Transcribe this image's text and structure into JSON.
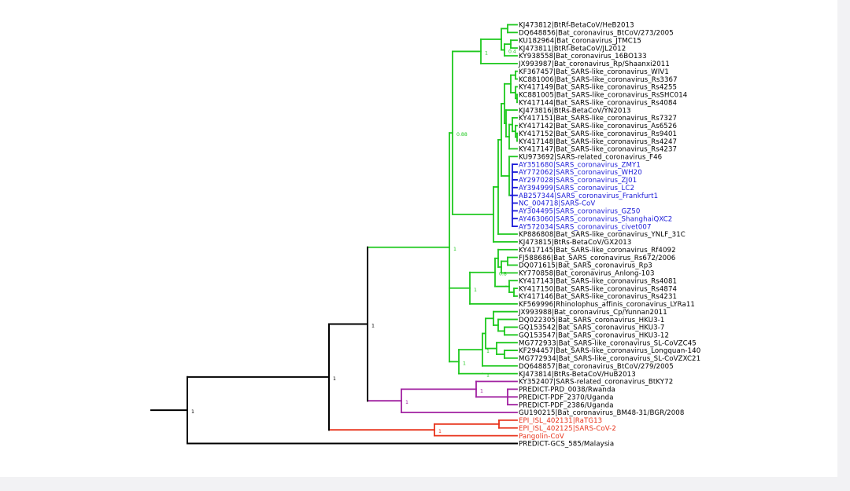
{
  "colors": {
    "black": "#000000",
    "green": "#1ec81e",
    "blue": "#1a1ad8",
    "purple": "#a020a0",
    "red": "#e8341c",
    "support_text": "#1ec81e"
  },
  "tree": {
    "taxa": [
      {
        "label": "KJ473812|BtRf-BetaCoV/HeB2013",
        "color": "black"
      },
      {
        "label": "DQ648856|Bat_coronavirus_BtCoV/273/2005",
        "color": "black"
      },
      {
        "label": "KU182964|Bat_coronavirus_JTMC15",
        "color": "black"
      },
      {
        "label": "KJ473811|BtRf-BetaCoV/JL2012",
        "color": "black"
      },
      {
        "label": "KY938558|Bat_coronavirus_16BO133",
        "color": "black"
      },
      {
        "label": "JX993987|Bat_coronavirus_Rp/Shaanxi2011",
        "color": "black"
      },
      {
        "label": "KF367457|Bat_SARS-like_coronavirus_WIV1",
        "color": "black"
      },
      {
        "label": "KC881006|Bat_SARS-like_coronavirus_Rs3367",
        "color": "black"
      },
      {
        "label": "KY417149|Bat_SARS-like_coronavirus_Rs4255",
        "color": "black"
      },
      {
        "label": "KC881005|Bat_SARS-like_coronavirus_RsSHC014",
        "color": "black"
      },
      {
        "label": "KY417144|Bat_SARS-like_coronavirus_Rs4084",
        "color": "black"
      },
      {
        "label": "KJ473816|BtRs-BetaCoV/YN2013",
        "color": "black"
      },
      {
        "label": "KY417151|Bat_SARS-like_coronavirus_Rs7327",
        "color": "black"
      },
      {
        "label": "KY417142|Bat_SARS-like_coronavirus_As6526",
        "color": "black"
      },
      {
        "label": "KY417152|Bat_SARS-like_coronavirus_Rs9401",
        "color": "black"
      },
      {
        "label": "KY417148|Bat_SARS-like_coronavirus_Rs4247",
        "color": "black"
      },
      {
        "label": "KY417147|Bat_SARS-like_coronavirus_Rs4237",
        "color": "black"
      },
      {
        "label": "KU973692|SARS-related_coronavirus_F46",
        "color": "black"
      },
      {
        "label": "AY351680|SARS_coronavirus_ZMY1",
        "color": "blue"
      },
      {
        "label": "AY772062|SARS_coronavirus_WH20",
        "color": "blue"
      },
      {
        "label": "AY297028|SARS_coronavirus_ZJ01",
        "color": "blue"
      },
      {
        "label": "AY394999|SARS_coronavirus_LC2",
        "color": "blue"
      },
      {
        "label": "AB257344|SARS_coronavirus_Frankfurt1",
        "color": "blue"
      },
      {
        "label": "NC_004718|SARS-CoV",
        "color": "blue"
      },
      {
        "label": "AY304495|SARS_coronavirus_GZ50",
        "color": "blue"
      },
      {
        "label": "AY463060|SARS_coronavirus_ShanghaiQXC2",
        "color": "blue"
      },
      {
        "label": "AY572034|SARS_coronavirus_civet007",
        "color": "blue"
      },
      {
        "label": "KP886808|Bat_SARS-like_coronavirus_YNLF_31C",
        "color": "black"
      },
      {
        "label": "KJ473815|BtRs-BetaCoV/GX2013",
        "color": "black"
      },
      {
        "label": "KY417145|Bat_SARS-like_coronavirus_Rf4092",
        "color": "black"
      },
      {
        "label": "FJ588686|Bat_SARS_coronavirus_Rs672/2006",
        "color": "black"
      },
      {
        "label": "DQ071615|Bat_SARS_coronavirus_Rp3",
        "color": "black"
      },
      {
        "label": "KY770858|Bat_coronavirus_Anlong-103",
        "color": "black"
      },
      {
        "label": "KY417143|Bat_SARS-like_coronavirus_Rs4081",
        "color": "black"
      },
      {
        "label": "KY417150|Bat_SARS-like_coronavirus_Rs4874",
        "color": "black"
      },
      {
        "label": "KY417146|Bat_SARS-like_coronavirus_Rs4231",
        "color": "black"
      },
      {
        "label": "KF569996|Rhinolophus_affinis_coronavirus_LYRa11",
        "color": "black"
      },
      {
        "label": "JX993988|Bat_coronavirus_Cp/Yunnan2011",
        "color": "black"
      },
      {
        "label": "DQ022305|Bat_SARS_coronavirus_HKU3-1",
        "color": "black"
      },
      {
        "label": "GQ153542|Bat_SARS_coronavirus_HKU3-7",
        "color": "black"
      },
      {
        "label": "GQ153547|Bat_SARS_coronavirus_HKU3-12",
        "color": "black"
      },
      {
        "label": "MG772933|Bat_SARS-like_coronavirus_SL-CoVZC45",
        "color": "black"
      },
      {
        "label": "KF294457|Bat_SARS-like_coronavirus_Longquan-140",
        "color": "black"
      },
      {
        "label": "MG772934|Bat_SARS-like_coronavirus_SL-CoVZXC21",
        "color": "black"
      },
      {
        "label": "DQ648857|Bat_coronavirus_BtCoV/279/2005",
        "color": "black"
      },
      {
        "label": "KJ473814|BtRs-BetaCoV/HuB2013",
        "color": "black"
      },
      {
        "label": "KY352407|SARS-related_coronavirus_BtKY72",
        "color": "black"
      },
      {
        "label": "PREDICT-PRD_0038/Rwanda",
        "color": "black"
      },
      {
        "label": "PREDICT-PDF_2370/Uganda",
        "color": "black"
      },
      {
        "label": "PREDICT-PDF_2386/Uganda",
        "color": "black"
      },
      {
        "label": "GU190215|Bat_coronavirus_BM48-31/BGR/2008",
        "color": "black"
      },
      {
        "label": "EPI_ISL_402131|RaTG13",
        "color": "red"
      },
      {
        "label": "EPI_ISL_402125|SARS-CoV-2",
        "color": "red"
      },
      {
        "label": "Pangolin-CoV",
        "color": "red"
      },
      {
        "label": "PREDICT-GCS_585/Malaysia",
        "color": "black"
      }
    ],
    "support_values": [
      {
        "node": "root",
        "value": "1",
        "color": "black"
      },
      {
        "node": "n1",
        "value": "1",
        "color": "black"
      },
      {
        "node": "n2",
        "value": "1",
        "color": "black"
      },
      {
        "node": "green_clade",
        "value": "1",
        "color": "green"
      },
      {
        "node": "n_sarsrelated",
        "value": "0.88",
        "color": "green"
      },
      {
        "node": "n_hebei",
        "value": "1",
        "color": "green"
      },
      {
        "node": "n_rf",
        "value": "0.4",
        "color": "green"
      },
      {
        "node": "n_rp3",
        "value": "1",
        "color": "green"
      },
      {
        "node": "n_rp3_inner",
        "value": "0.8",
        "color": "green"
      },
      {
        "node": "n_hku3",
        "value": "1",
        "color": "green"
      },
      {
        "node": "n_zc",
        "value": "1",
        "color": "green"
      },
      {
        "node": "n_hub",
        "value": "1",
        "color": "green"
      },
      {
        "node": "purple_clade",
        "value": "1",
        "color": "purple"
      },
      {
        "node": "purple_inner",
        "value": "1",
        "color": "purple"
      },
      {
        "node": "red_clade",
        "value": "1",
        "color": "red"
      }
    ]
  }
}
